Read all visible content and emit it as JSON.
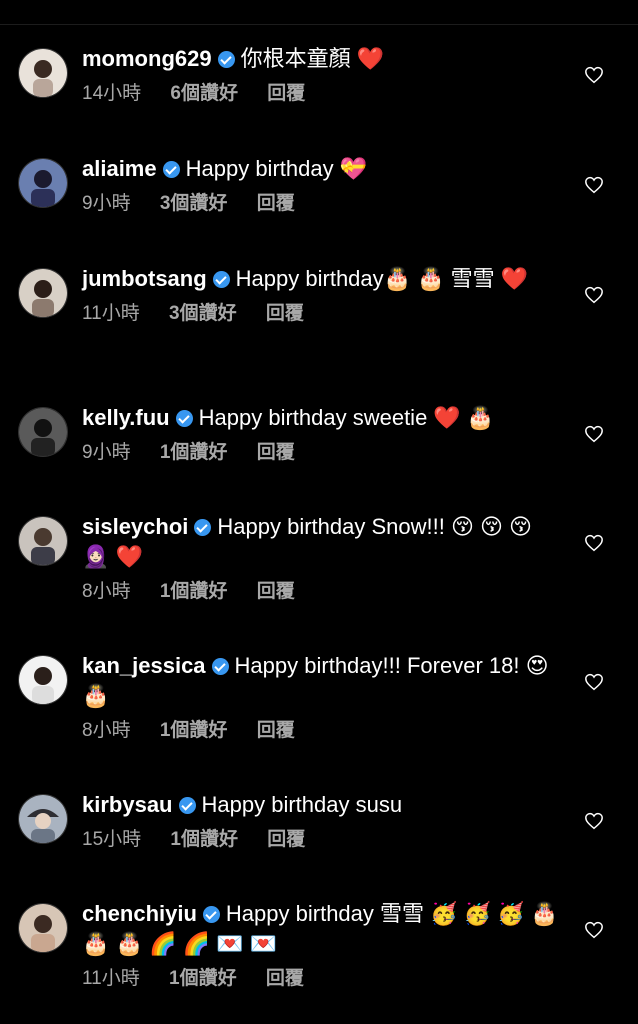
{
  "comments": [
    {
      "username": "momong629",
      "text": "你根本童顏 ❤️",
      "time": "14小時",
      "likes": "6個讚好",
      "reply": "回覆"
    },
    {
      "username": "aliaime",
      "text": "Happy birthday 💝",
      "time": "9小時",
      "likes": "3個讚好",
      "reply": "回覆"
    },
    {
      "username": "jumbotsang",
      "text": "Happy birthday🎂 🎂 雪雪 ❤️",
      "time": "11小時",
      "likes": "3個讚好",
      "reply": "回覆"
    },
    {
      "username": "kelly.fuu",
      "text": "Happy birthday sweetie ❤️ 🎂",
      "time": "9小時",
      "likes": "1個讚好",
      "reply": "回覆"
    },
    {
      "username": "sisleychoi",
      "text": "Happy birthday Snow!!! 😚 😚 😚 🧕🏻 ❤️",
      "time": "8小時",
      "likes": "1個讚好",
      "reply": "回覆"
    },
    {
      "username": "kan_jessica",
      "text": "Happy birthday!!! Forever 18! 😍 🎂",
      "time": "8小時",
      "likes": "1個讚好",
      "reply": "回覆"
    },
    {
      "username": "kirbysau",
      "text": "Happy birthday susu",
      "time": "15小時",
      "likes": "1個讚好",
      "reply": "回覆"
    },
    {
      "username": "chenchiyiu",
      "text": "Happy birthday 雪雪 🥳 🥳 🥳 🎂 🎂 🎂 🌈 🌈 💌 💌",
      "time": "11小時",
      "likes": "1個讚好",
      "reply": "回覆"
    }
  ],
  "colors": {
    "background": "#000000",
    "meta": "#a8a8a8",
    "verified": "#3897f0"
  },
  "icons": {
    "verified": "verified-badge-icon",
    "like": "heart-outline-icon",
    "avatar": "user-avatar"
  }
}
